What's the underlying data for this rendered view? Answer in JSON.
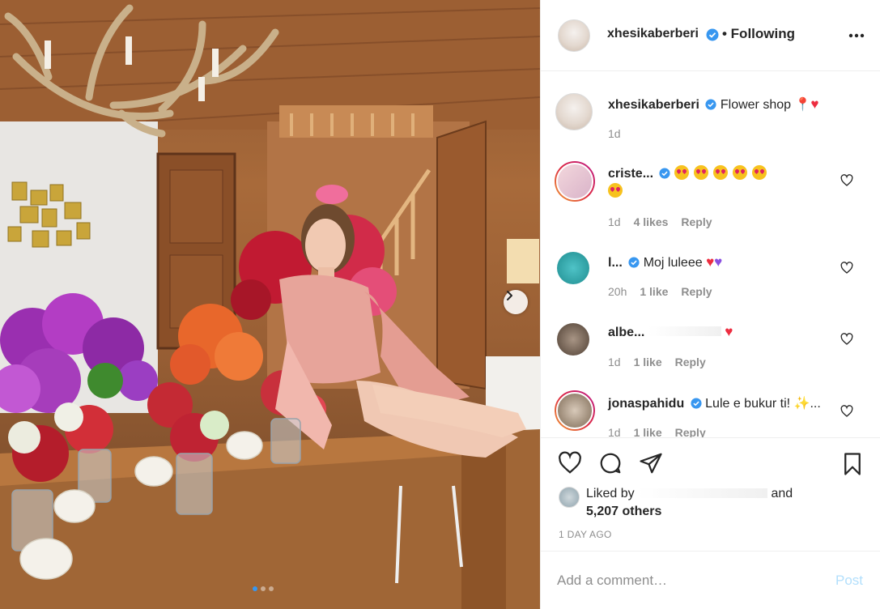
{
  "post": {
    "author": "xhesikaberberi",
    "follow_state": "• Following",
    "caption": "Flower shop",
    "caption_time": "1d"
  },
  "comments": [
    {
      "username": "criste...",
      "text": "",
      "time": "1d",
      "likes": "4 likes",
      "reply": "Reply"
    },
    {
      "username": "l...",
      "text": "Moj luleee",
      "time": "20h",
      "likes": "1 like",
      "reply": "Reply"
    },
    {
      "username": "albe...",
      "text": "",
      "time": "1d",
      "likes": "1 like",
      "reply": "Reply"
    },
    {
      "username": "jonaspahidu",
      "text": "Lule e bukur ti!",
      "time": "1d",
      "likes": "1 like",
      "reply": "Reply"
    }
  ],
  "likes": {
    "prefix": "Liked by",
    "suffix": "and",
    "others": "5,207 others"
  },
  "timestamp": "1 DAY AGO",
  "comment_box": {
    "placeholder": "Add a comment…",
    "post_label": "Post"
  },
  "colors": {
    "verified": "#3897f0",
    "post_button_disabled": "#b2dffc",
    "muted_text": "#8e8e8e"
  },
  "icons": [
    "heart-icon",
    "comment-icon",
    "share-icon",
    "bookmark-icon",
    "more-icon",
    "chevron-right-icon",
    "verified-badge-icon"
  ]
}
